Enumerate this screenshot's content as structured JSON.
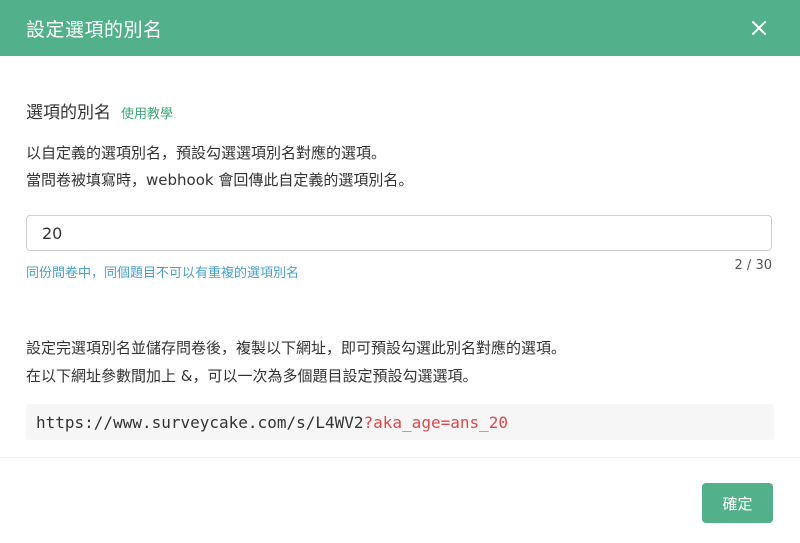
{
  "header": {
    "title": "設定選項的別名",
    "close_icon": "close-icon"
  },
  "section": {
    "title": "選項的別名",
    "tutorial_link": "使用教學",
    "description_line1": "以自定義的選項別名，預設勾選選項別名對應的選項。",
    "description_line2": "當問卷被填寫時，webhook 會回傳此自定義的選項別名。"
  },
  "alias_input": {
    "value": "20",
    "hint": "同份問卷中，同個題目不可以有重複的選項別名",
    "counter": "2 / 30"
  },
  "url_section": {
    "description_line1": "設定完選項別名並儲存問卷後，複製以下網址，即可預設勾選此別名對應的選項。",
    "description_line2": "在以下網址參數間加上 &，可以一次為多個題目設定預設勾選選項。",
    "url_base": "https://www.surveycake.com/s/L4WV2",
    "url_param": "?aka_age=ans_20"
  },
  "footer": {
    "confirm_label": "確定"
  },
  "colors": {
    "accent": "#52b08a",
    "link": "#3da676",
    "hint": "#4aa0c9",
    "param": "#e0474c"
  }
}
